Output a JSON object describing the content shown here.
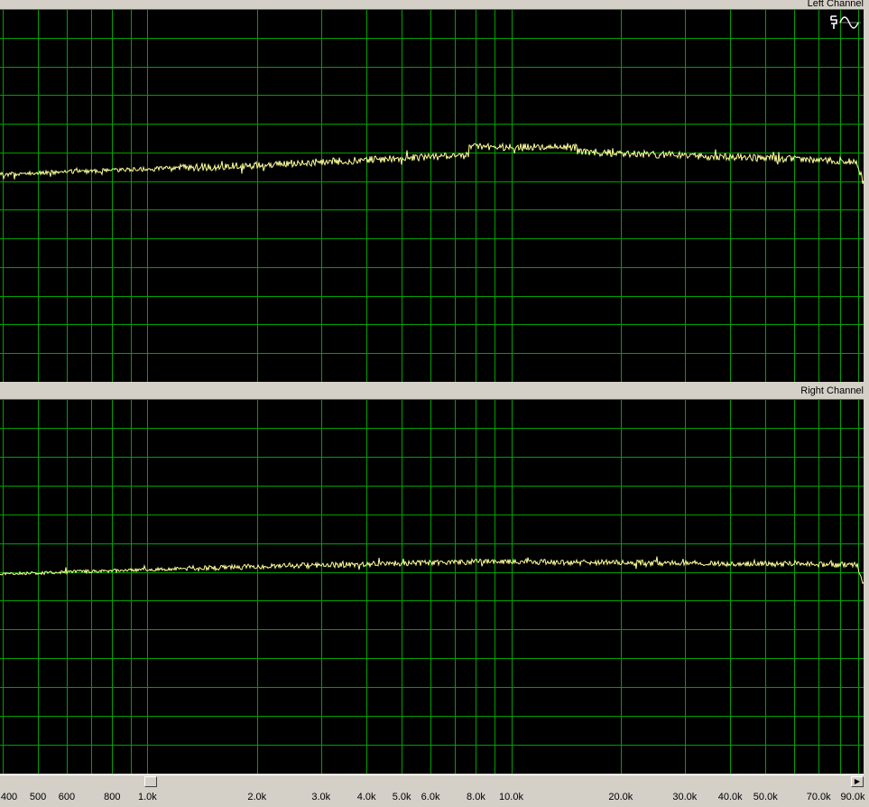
{
  "panels": {
    "left": {
      "title": "Left Channel"
    },
    "right": {
      "title": "Right Channel"
    }
  },
  "axis": {
    "scale": "log",
    "unit": "Hz",
    "ticks": [
      {
        "label": "400",
        "hz": 400
      },
      {
        "label": "500",
        "hz": 500
      },
      {
        "label": "600",
        "hz": 600
      },
      {
        "label": "800",
        "hz": 800
      },
      {
        "label": "1.0k",
        "hz": 1000
      },
      {
        "label": "2.0k",
        "hz": 2000
      },
      {
        "label": "3.0k",
        "hz": 3000
      },
      {
        "label": "4.0k",
        "hz": 4000
      },
      {
        "label": "5.0k",
        "hz": 5000
      },
      {
        "label": "6.0k",
        "hz": 6000
      },
      {
        "label": "8.0k",
        "hz": 8000
      },
      {
        "label": "10.0k",
        "hz": 10000
      },
      {
        "label": "20.0k",
        "hz": 20000
      },
      {
        "label": "30.0k",
        "hz": 30000
      },
      {
        "label": "40.0k",
        "hz": 40000
      },
      {
        "label": "50.0k",
        "hz": 50000
      },
      {
        "label": "70.0k",
        "hz": 70000
      },
      {
        "label": "90.0k",
        "hz": 90000
      }
    ]
  },
  "colors": {
    "grid": "#00a000",
    "trace": "#ffff99",
    "background": "#000000"
  },
  "icons": [
    "spectrum-settings-icon",
    "waveform-icon"
  ]
}
